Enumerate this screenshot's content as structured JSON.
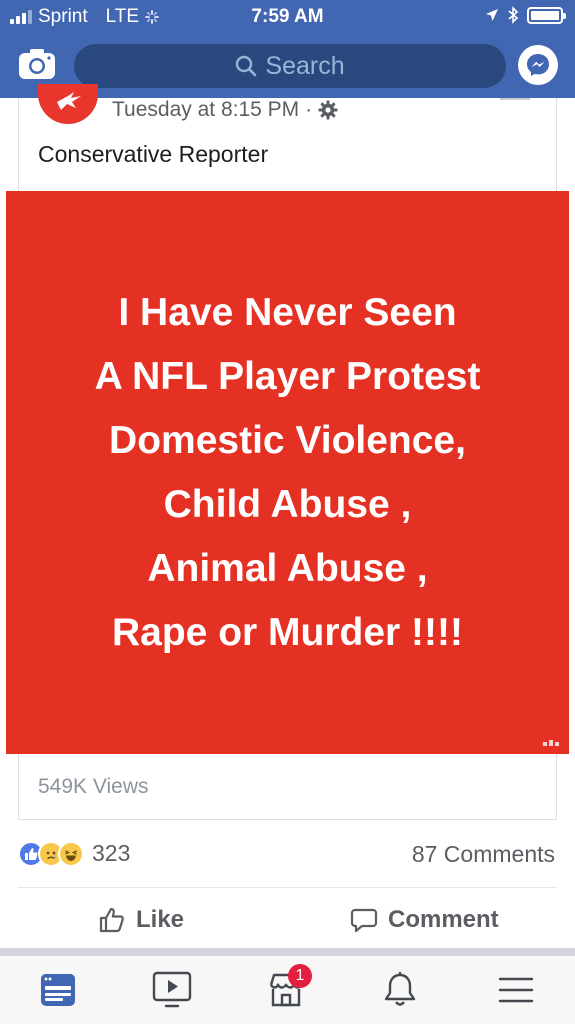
{
  "status_bar": {
    "carrier": "Sprint",
    "network": "LTE",
    "time": "7:59 AM",
    "battery_level": 1.0
  },
  "header": {
    "search_placeholder": "Search",
    "brand_color": "#4267b2",
    "icons": [
      "camera-icon",
      "search-icon",
      "messenger-icon"
    ]
  },
  "post": {
    "timestamp": "Tuesday at 8:15 PM",
    "separator": "·",
    "author": "Conservative Reporter",
    "image_lines": [
      "I Have Never Seen",
      "A NFL Player Protest",
      "Domestic Violence,",
      "Child Abuse ,",
      "Animal Abuse ,",
      "Rape or Murder !!!!"
    ],
    "image_background": "#e53124",
    "views": "549K Views"
  },
  "engagement": {
    "reaction_icons": [
      "like-reaction-icon",
      "sad-reaction-icon",
      "haha-reaction-icon"
    ],
    "reaction_count": "323",
    "comments": "87 Comments"
  },
  "actions": {
    "like_label": "Like",
    "comment_label": "Comment"
  },
  "bottom_nav": {
    "items": [
      "news-feed-icon",
      "watch-icon",
      "marketplace-icon",
      "notifications-icon",
      "menu-icon"
    ],
    "marketplace_badge": "1",
    "active_color": "#4267b2"
  }
}
